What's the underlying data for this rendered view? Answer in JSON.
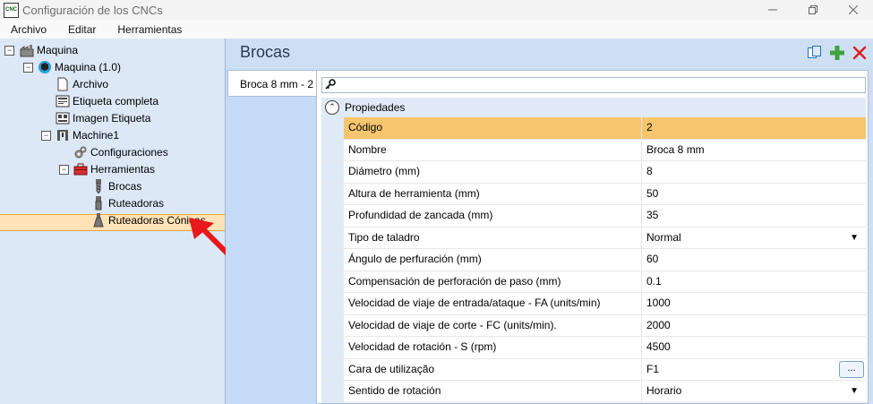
{
  "window": {
    "title": "Configuración de los CNCs",
    "app_icon_text": "CNC"
  },
  "menu": [
    "Archivo",
    "Editar",
    "Herramientas"
  ],
  "tree": [
    {
      "label": "Maquina",
      "icon": "factory-icon"
    },
    {
      "label": "Maquina (1.0)",
      "icon": "machine-cube-icon"
    },
    {
      "label": "Archivo",
      "icon": "file-icon"
    },
    {
      "label": "Etiqueta completa",
      "icon": "label-icon"
    },
    {
      "label": "Imagen Etiqueta",
      "icon": "label-image-icon"
    },
    {
      "label": "Machine1",
      "icon": "cnc-machine-icon"
    },
    {
      "label": "Configuraciones",
      "icon": "gears-icon"
    },
    {
      "label": "Herramientas",
      "icon": "toolbox-icon"
    },
    {
      "label": "Brocas",
      "icon": "drill-bit-icon"
    },
    {
      "label": "Ruteadoras",
      "icon": "router-bit-icon"
    },
    {
      "label": "Ruteadoras Cónicas",
      "icon": "conical-router-icon"
    }
  ],
  "panel": {
    "title": "Brocas",
    "tab_label": "Broca 8 mm - 2",
    "category": "Propiedades",
    "colors": {
      "selected_row": "#f7c56e",
      "tree_selection": "#ffe2b6",
      "add": "#3ea33e",
      "delete": "#e02020"
    },
    "properties": [
      {
        "name": "Código",
        "value": "2"
      },
      {
        "name": "Nombre",
        "value": "Broca 8 mm"
      },
      {
        "name": "Diámetro (mm)",
        "value": "8"
      },
      {
        "name": "Altura de herramienta (mm)",
        "value": "50"
      },
      {
        "name": "Profundidad de zancada (mm)",
        "value": "35"
      },
      {
        "name": "Tipo de taladro",
        "value": "Normal"
      },
      {
        "name": "Ángulo de perfuración (mm)",
        "value": "60"
      },
      {
        "name": "Compensación de perforación de paso (mm)",
        "value": "0.1"
      },
      {
        "name": "Velocidad de viaje de entrada/ataque - FA (units/min)",
        "value": "1000"
      },
      {
        "name": "Velocidad de viaje de corte - FC (units/min).",
        "value": "2000"
      },
      {
        "name": "Velocidad de rotación - S (rpm)",
        "value": "4500"
      },
      {
        "name": "Cara de utilização",
        "value": "F1"
      },
      {
        "name": "Sentido de rotación",
        "value": "Horario"
      }
    ],
    "ellipsis_label": "..."
  }
}
